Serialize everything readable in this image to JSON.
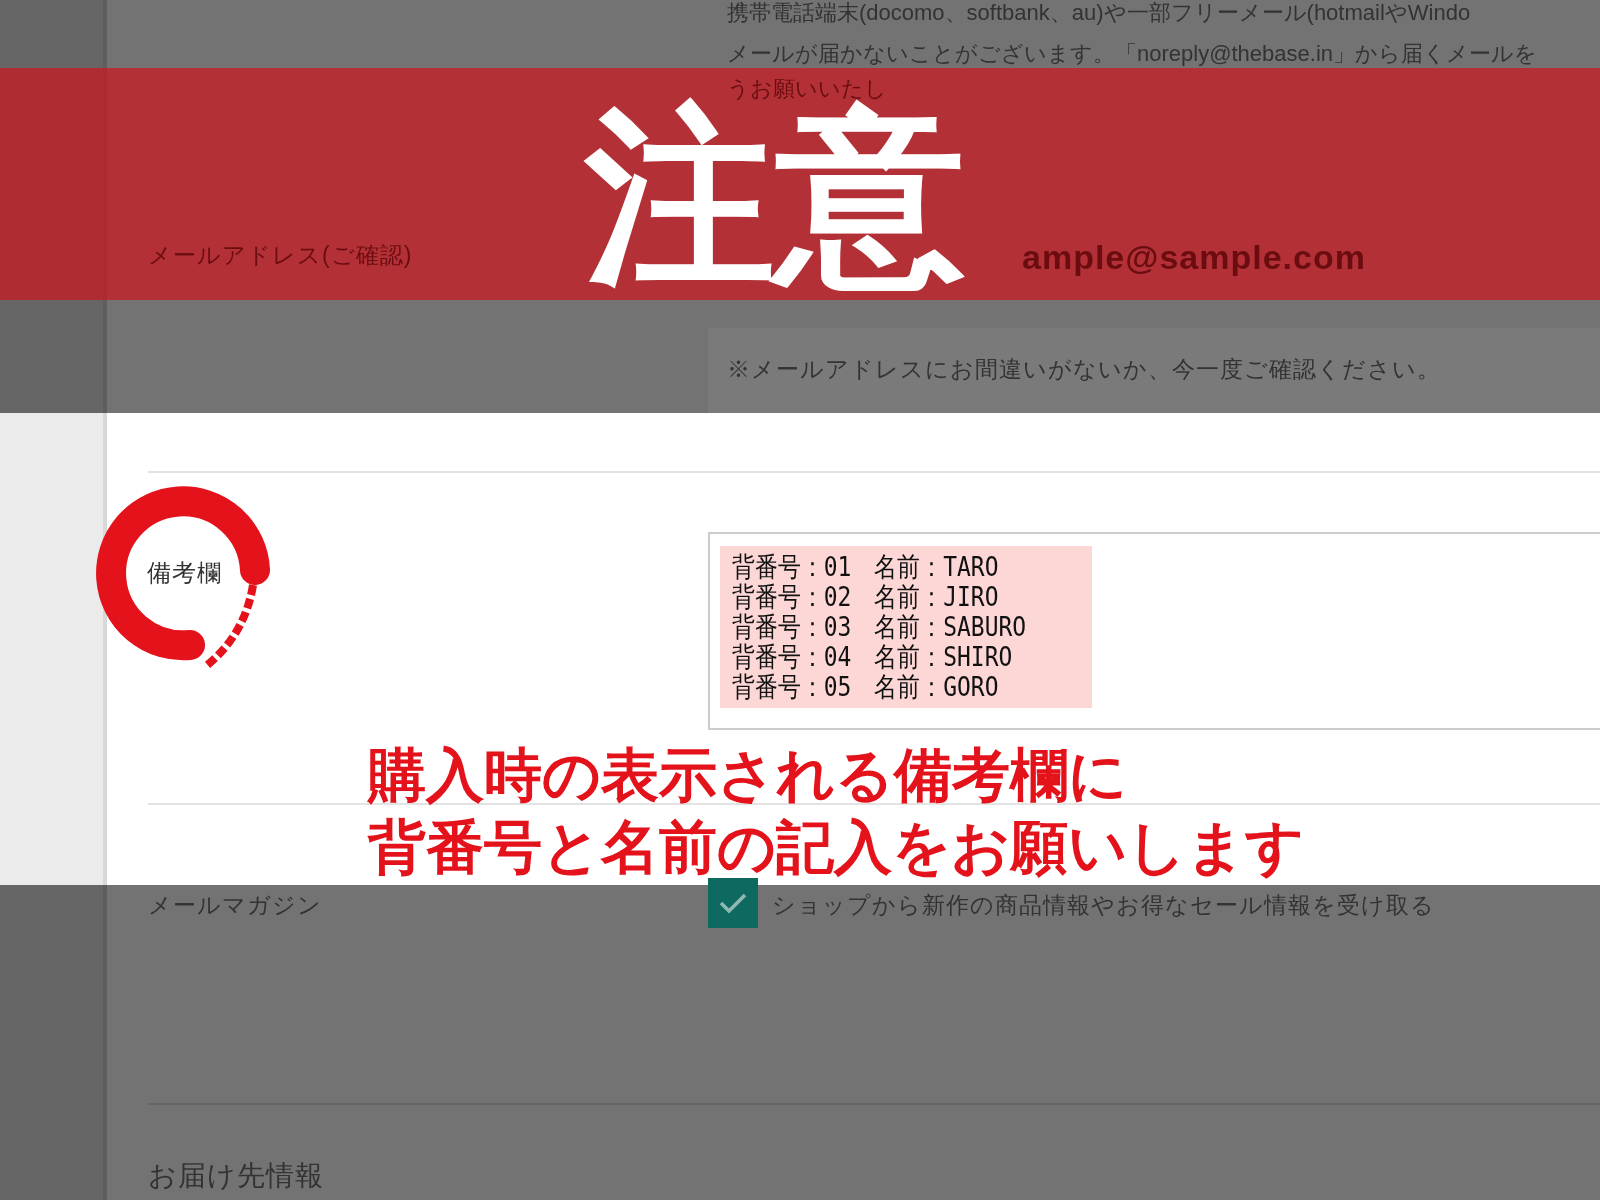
{
  "notice_banner": {
    "title": "注意"
  },
  "email_notice_lines": [
    "携帯電話端末(docomo、softbank、au)や一部フリーメール(hotmailやWindo",
    "メールが届かないことがございます。「noreply@thebase.in」から届くメールを",
    "うお願いいたし"
  ],
  "email_confirm": {
    "label": "メールアドレス(ご確認)",
    "value": "ample@sample.com"
  },
  "email_hint": "※メールアドレスにお間違いがないか、今一度ご確認ください。",
  "remarks": {
    "label": "備考欄",
    "lines": [
      "背番号：01　名前：TARO",
      "背番号：02　名前：JIRO",
      "背番号：03　名前：SABURO",
      "背番号：04　名前：SHIRO",
      "背番号：05　名前：GORO"
    ]
  },
  "instruction_lines": [
    "購入時の表示される備考欄に",
    "背番号と名前の記入をお願いします"
  ],
  "newsletter": {
    "label": "メールマガジン",
    "checked": true,
    "option": "ショップから新作の商品情報やお得なセール情報を受け取る"
  },
  "next_section": {
    "title": "お届け先情報"
  }
}
